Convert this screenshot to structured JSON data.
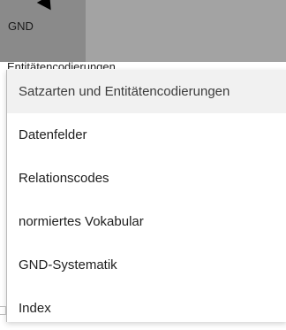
{
  "header": {
    "tab_label": "GND",
    "subtitle_peek": "Entitätencodierungen"
  },
  "menu": {
    "items": [
      {
        "label": "Satzarten und Entitätencodierungen",
        "active": true
      },
      {
        "label": "Datenfelder"
      },
      {
        "label": "Relationscodes"
      },
      {
        "label": "normiertes Vokabular"
      },
      {
        "label": "GND-Systematik"
      },
      {
        "label": "Index"
      }
    ]
  },
  "colors": {
    "topbar": "#a3a3a3",
    "tab": "#8a8a8a",
    "active_item": "#f1f1f1"
  }
}
